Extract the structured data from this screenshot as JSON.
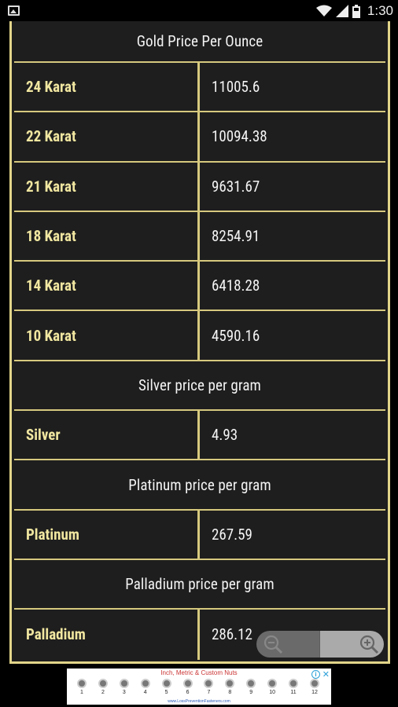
{
  "status_bar": {
    "time": "1:30",
    "icons": [
      "image-icon",
      "wifi-icon",
      "signal-icon",
      "battery-icon"
    ]
  },
  "table": {
    "gold_header": "Gold Price Per Ounce",
    "gold_rows": [
      {
        "label": "24 Karat",
        "value": "11005.6"
      },
      {
        "label": "22 Karat",
        "value": "10094.38"
      },
      {
        "label": "21 Karat",
        "value": "9631.67"
      },
      {
        "label": "18 Karat",
        "value": "8254.91"
      },
      {
        "label": "14 Karat",
        "value": "6418.28"
      },
      {
        "label": "10 Karat",
        "value": "4590.16"
      }
    ],
    "silver_header": "Silver price per gram",
    "silver_row": {
      "label": "Silver",
      "value": "4.93"
    },
    "platinum_header": "Platinum price per gram",
    "platinum_row": {
      "label": "Platinum",
      "value": "267.59"
    },
    "palladium_header": "Palladium price per gram",
    "palladium_row": {
      "label": "Palladium",
      "value": "286.12"
    }
  },
  "zoom": {
    "icons": [
      "zoom-out-icon",
      "zoom-in-icon"
    ]
  },
  "ad": {
    "title": "Inch, Metric & Custom Nuts",
    "numbers": [
      "1",
      "2",
      "3",
      "4",
      "5",
      "6",
      "7",
      "8",
      "9",
      "10",
      "11",
      "12"
    ],
    "footer": "www.LossPreventionFasteners.com",
    "info": "i",
    "close": "✕"
  },
  "colors": {
    "border": "#e2d58a",
    "label": "#f0e6a0",
    "cell_bg": "#1e1e1e"
  }
}
